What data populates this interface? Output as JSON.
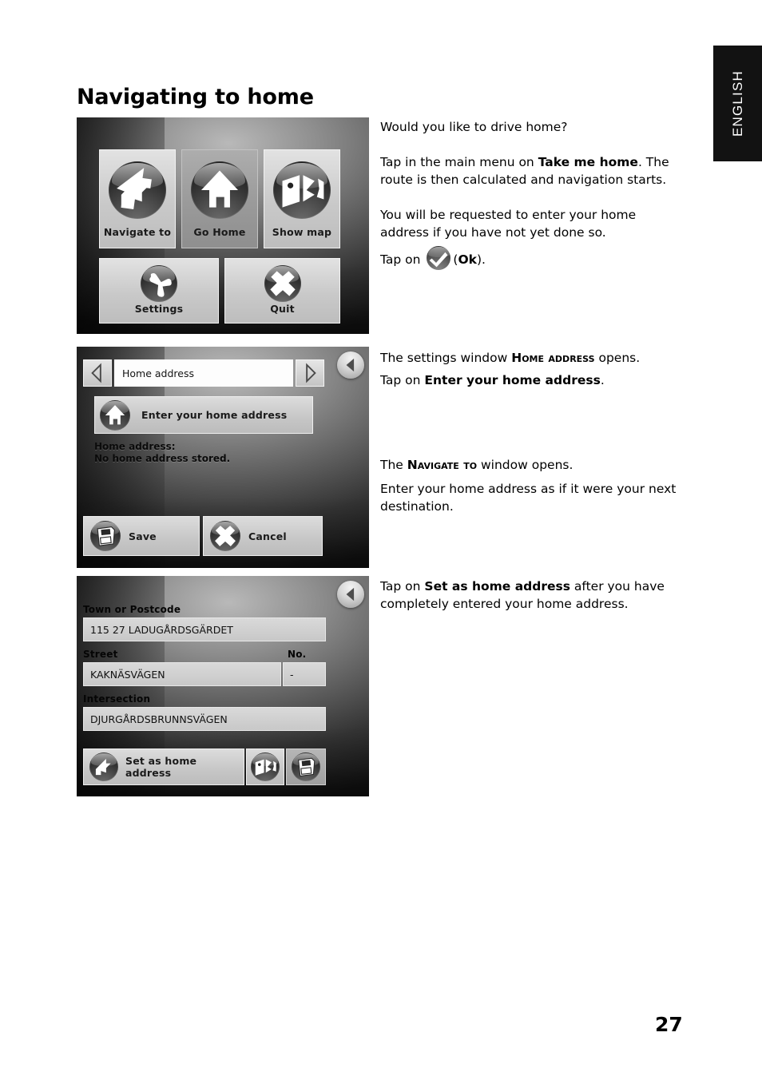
{
  "document": {
    "page_title": "Navigating to home",
    "page_number": "27",
    "language_tab": "ENGLISH"
  },
  "screenshots": {
    "main_menu": {
      "tiles": [
        {
          "label": "Navigate to",
          "icon": "arrow-up-right-icon"
        },
        {
          "label": "Go Home",
          "icon": "house-icon"
        },
        {
          "label": "Show map",
          "icon": "map-icon"
        },
        {
          "label": "Settings",
          "icon": "wrench-icon"
        },
        {
          "label": "Quit",
          "icon": "cross-icon"
        }
      ]
    },
    "home_address": {
      "back_button_icon": "back-arrow-icon",
      "prev_icon": "triangle-left-icon",
      "next_icon": "triangle-right-icon",
      "title_field": "Home address",
      "enter_button": "Enter your home address",
      "enter_button_icon": "house-icon",
      "status_line_1": "Home address:",
      "status_line_2": "No home address stored.",
      "save_button": "Save",
      "save_button_icon": "floppy-disk-icon",
      "cancel_button": "Cancel",
      "cancel_button_icon": "cross-icon"
    },
    "navigate_to": {
      "back_button_icon": "back-arrow-icon",
      "fields": [
        {
          "label": "Town or Postcode",
          "value": "115 27 LADUGÅRDSGÄRDET"
        },
        {
          "label": "Street",
          "value": "KAKNÄSVÄGEN"
        },
        {
          "label": "No.",
          "value": "-"
        },
        {
          "label": "Intersection",
          "value": "DJURGÅRDSBRUNNSVÄGEN"
        }
      ],
      "set_home_button": "Set as home address",
      "set_home_button_icon": "arrow-up-right-icon",
      "map_button_icon": "map-icon",
      "save_button_icon": "floppy-disk-icon"
    }
  },
  "text": {
    "block1_line1": "Would you like to drive home?",
    "block1_p2_pre": "Tap in the main menu on ",
    "block1_p2_bold": "Take me home",
    "block1_p2_post": ". The route is then calculated and navigation starts.",
    "block1_p3": "You will be requested to enter your home address if you have not yet done so.",
    "block1_p4_pre": "Tap on ",
    "block1_p4_post_open": "(",
    "block1_p4_bold": "Ok",
    "block1_p4_post_close": ").",
    "block2_p1_pre": "The settings window ",
    "block2_p1_sc": "Home address",
    "block2_p1_post": " opens.",
    "block2_p2_pre": "Tap on ",
    "block2_p2_bold": "Enter your home address",
    "block2_p2_post": ".",
    "block3_p1_pre": "The ",
    "block3_p1_sc": "Navigate to",
    "block3_p1_post": " window opens.",
    "block3_p2": "Enter your home address as if it were your next destination.",
    "block4_pre": "Tap on ",
    "block4_bold": "Set as home address",
    "block4_post": " after you have completely entered your home address."
  }
}
